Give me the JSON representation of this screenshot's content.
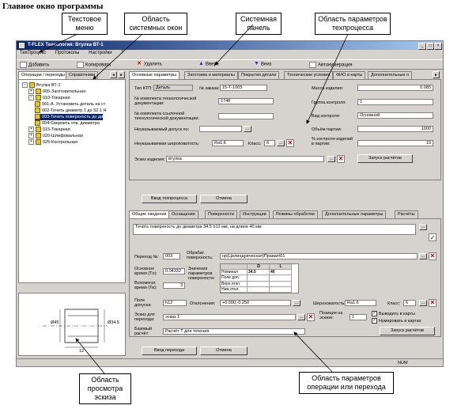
{
  "page": {
    "title": "Главное окно программы"
  },
  "callouts": {
    "text_menu": "Текстовое меню",
    "system_windows": "Область системных окон",
    "system_panel": "Системная панель",
    "tech_params": "Область параметров техпроцесса",
    "sketch_view": "Область просмотра эскиза",
    "operation_params": "Область параметров операции или перехода"
  },
  "window": {
    "title": "T-FLEX Технология: Втулка ВТ-1",
    "menu": [
      "ТехПроцесс",
      "Протоколы",
      "Настройки",
      "?"
    ],
    "toolbar": [
      "Добавить",
      "Копировать",
      "Удалить",
      "Вверх",
      "Вниз",
      "Автонумерация"
    ]
  },
  "tree": {
    "tabs": [
      "Операции / переходы",
      "Справочники"
    ],
    "items": [
      "Втулка ВТ-1",
      "005-Заготовительная",
      "010-Токарная",
      "001-А. Установить деталь на ст",
      "002-Точить диаметр 1 до 52.1 Н",
      "003-Точить поверхность до ди",
      "004-Сверлить отв. диаметро",
      "015-Токарная",
      "020-Шлифовальная",
      "025-Контрольная"
    ]
  },
  "sketch": {
    "dim_left": "Ø45",
    "dim_right": "Ø34.5",
    "dim_bottom": "12"
  },
  "process": {
    "tabs": [
      "Основные параметры",
      "Заготовка и материалы",
      "Покрытия детали",
      "Технические условия",
      "ФИО в карты",
      "Дополнительные п"
    ],
    "labels": {
      "tip_ktp": "Тип КТП:",
      "order_no": "№ заказа:",
      "mass": "Масса изделия:",
      "complect": "№ комплекта технологической документации:",
      "control_group": "Группа контроля:",
      "ref_complect": "№ комплекта ссылочной технологической документации:",
      "control_type": "Вид контроля:",
      "tolerance": "Неуказываемый допуск по:",
      "batch": "Объём партии:",
      "roughness": "Неуказываемая шероховатость:",
      "class": "Класс:",
      "pct_control": "% контроля изделий в партии:",
      "sketch_name": "Эскиз изделия:"
    },
    "values": {
      "tip_ktp": "Деталь",
      "order_no": "15-Т-1005",
      "mass": "0.085",
      "complect": "1748",
      "control_group": "1",
      "control_type": "Основной",
      "batch": "1000",
      "roughness": "Ra1,6",
      "class": "6",
      "pct_control": "10",
      "sketch_name": "втулка"
    },
    "buttons": {
      "run_calc": "Запуск расчётов",
      "enter": "Ввод техпроцесса",
      "cancel": "Отмена"
    }
  },
  "operation": {
    "tabs": [
      "Общие сведения",
      "Оснащение",
      "Поверхности",
      "Инструкции",
      "Режимы обработки",
      "Дополнительные параметры",
      "Расчёты"
    ],
    "text": "Точить поверхность до диаметра 34.5 h12 мм, на длине 40 мм",
    "labels": {
      "step_no": "Переход №:",
      "surface": "Обрабат. поверхность:",
      "main_time": "Основное время (Тo):",
      "param_values": "Значения параметров поверхности:",
      "aux_time": "Вспомогат. время (Тв):",
      "tolerance_field": "Поле допуска:",
      "deviations": "Отклонения:",
      "roughness": "Шероховатость:",
      "class": "Класс:",
      "sketch": "Эскиз для перехода:",
      "position": "Позиция на эскизе:",
      "base_calc": "Базовый расчёт:",
      "output": "Выводить в карты",
      "numbering": "Нумеровать в картах"
    },
    "values": {
      "step_no": "003",
      "surface": "нр(Цилиндрическая)Правая\\01",
      "main_time": "0.04332",
      "aux_time": "3",
      "tolerance_field": "h12",
      "deviations": "+0.000;-0.250",
      "roughness": "Ra1,6",
      "class": "6",
      "sketch": "эскиз 1",
      "position": "1",
      "base_calc": "Расчёт Т для точения"
    },
    "param_table": {
      "columns": [
        "",
        "D",
        "L"
      ],
      "rows": [
        [
          "Номинал",
          "34.5",
          "40"
        ],
        [
          "Поле доп.",
          "",
          ""
        ],
        [
          "Верх.откл.",
          "",
          ""
        ],
        [
          "Ниж.откл.",
          "",
          ""
        ]
      ]
    },
    "buttons": {
      "run_calc": "Запуск расчётов",
      "enter": "Ввод перехода",
      "cancel": "Отмена"
    }
  },
  "statusbar": {
    "num": "NUM"
  }
}
